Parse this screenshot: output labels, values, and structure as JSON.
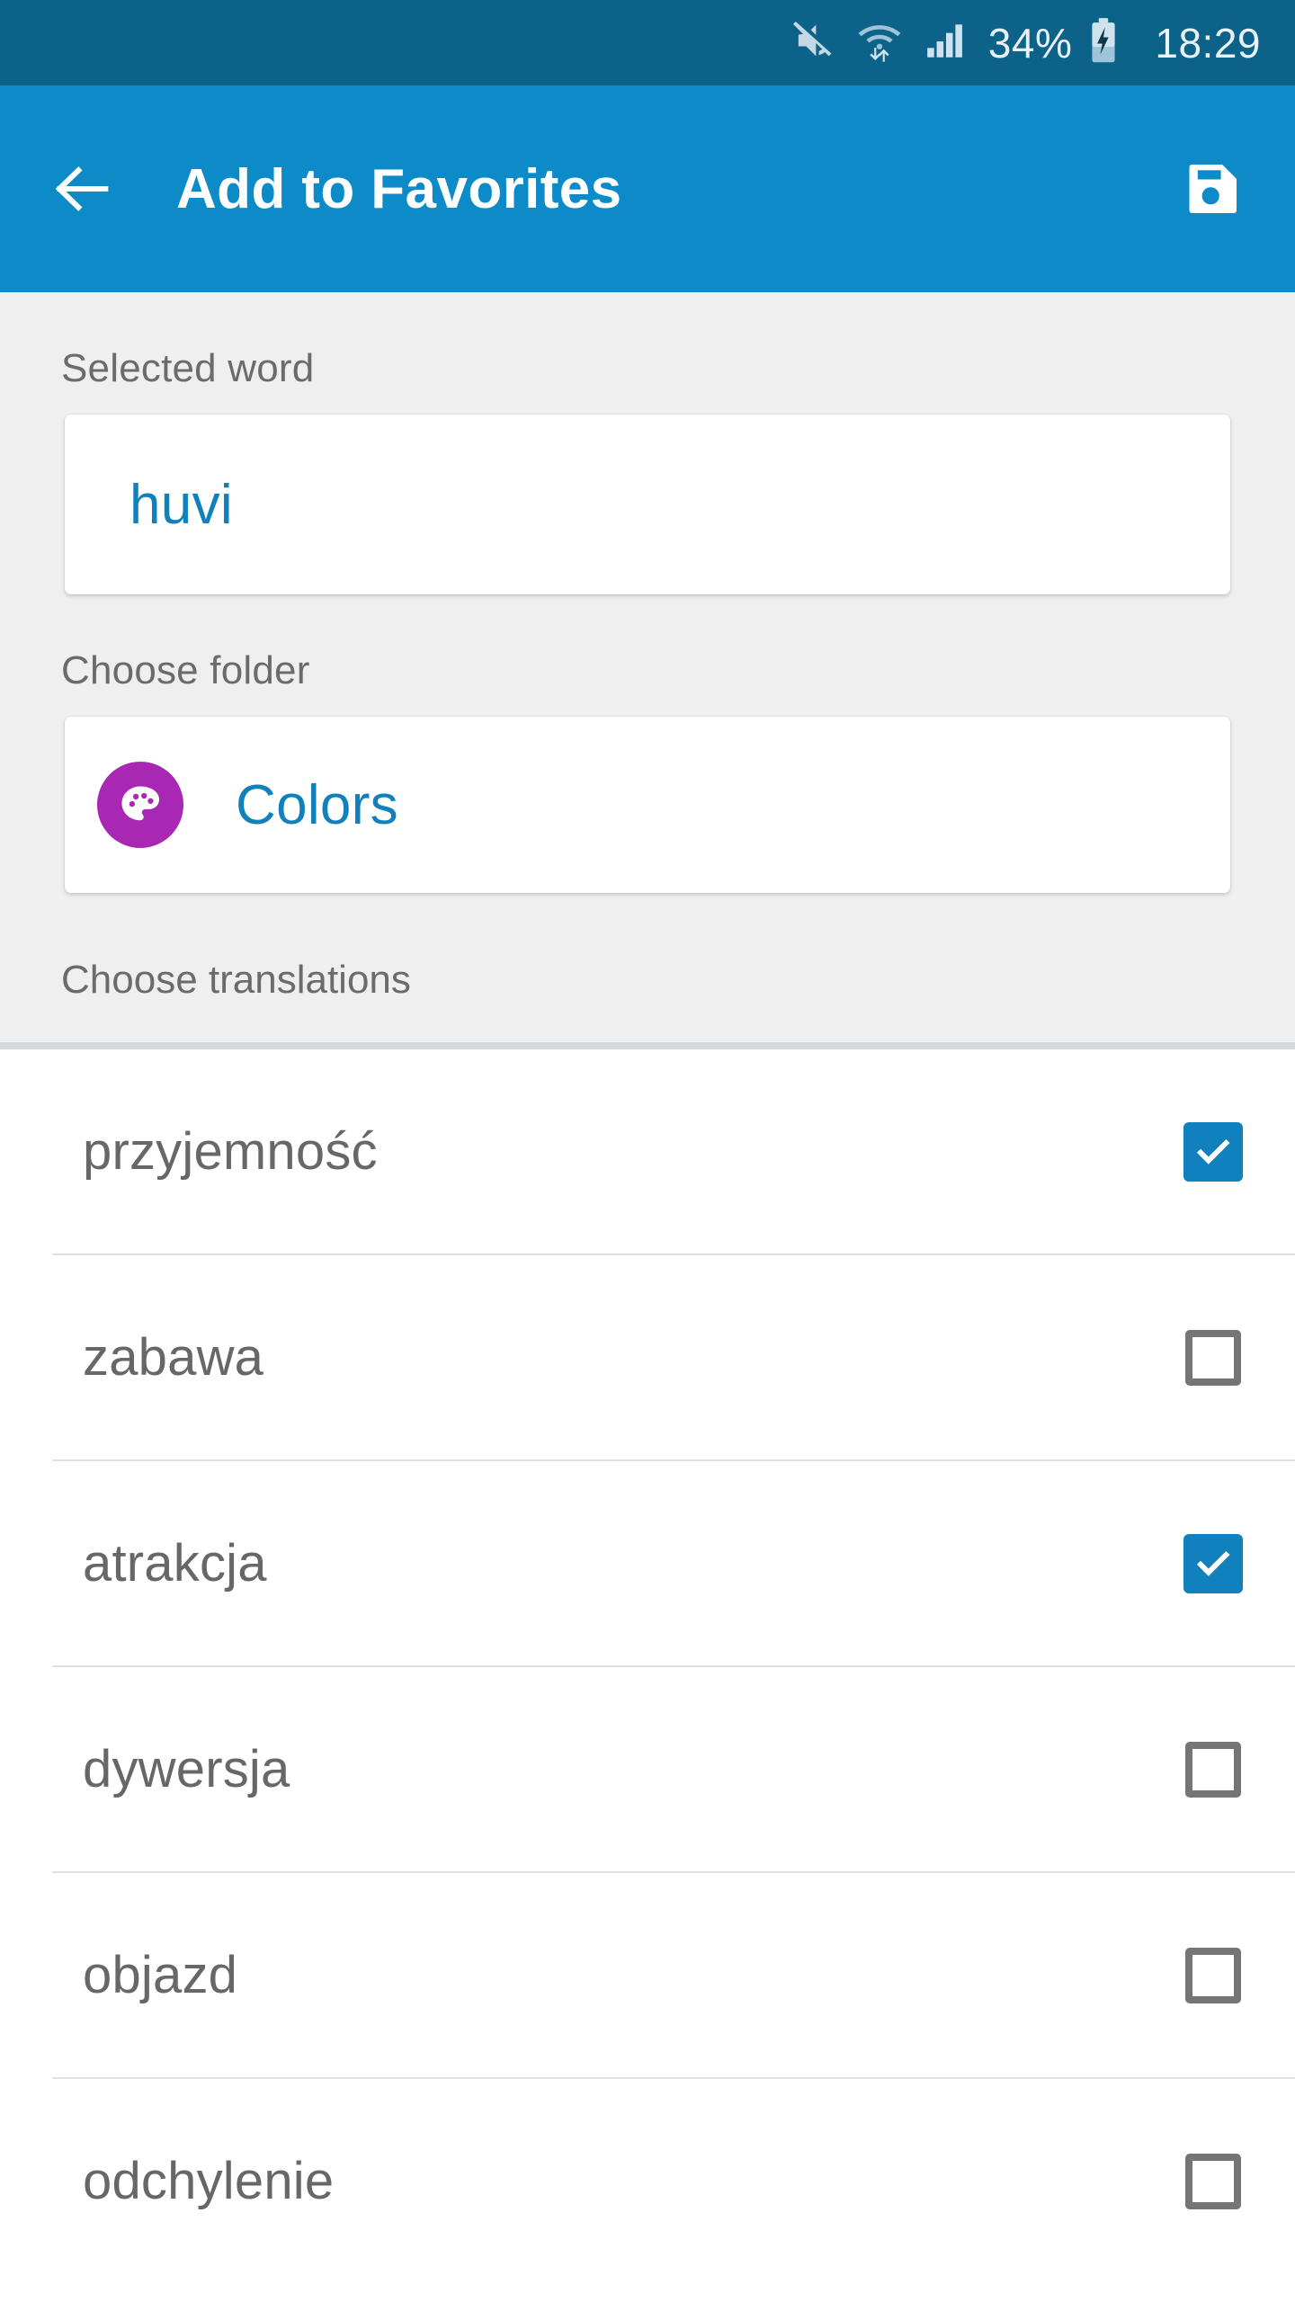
{
  "status_bar": {
    "icons": [
      "mute-icon",
      "wifi-icon",
      "signal-icon"
    ],
    "battery_percent": "34%",
    "battery_icon": "battery-charging-icon",
    "clock": "18:29",
    "background_color": "#0c6288",
    "text_color": "#e8f2f7"
  },
  "app_bar": {
    "back_label": "back-arrow",
    "title": "Add to Favorites",
    "save_label": "save-icon",
    "background_color": "#0d8bc9",
    "text_color": "#ffffff"
  },
  "form": {
    "selected_word_label": "Selected word",
    "selected_word_value": "huvi",
    "choose_folder_label": "Choose folder",
    "folder_name": "Colors",
    "folder_icon": "palette-icon",
    "folder_icon_color": "#a828b4",
    "choose_translations_label": "Choose translations",
    "value_color": "#1081bd",
    "label_color": "#6b6b6b",
    "background_color": "#efefef"
  },
  "translations": [
    {
      "text": "przyjemność",
      "checked": true
    },
    {
      "text": "zabawa",
      "checked": false
    },
    {
      "text": "atrakcja",
      "checked": true
    },
    {
      "text": "dywersja",
      "checked": false
    },
    {
      "text": "objazd",
      "checked": false
    },
    {
      "text": "odchylenie",
      "checked": false
    }
  ],
  "colors": {
    "accent": "#1081bd",
    "checkbox_checked": "#1081bd",
    "checkbox_unchecked_border": "#757575",
    "list_text": "#676767",
    "divider": "#e0e0e0"
  }
}
